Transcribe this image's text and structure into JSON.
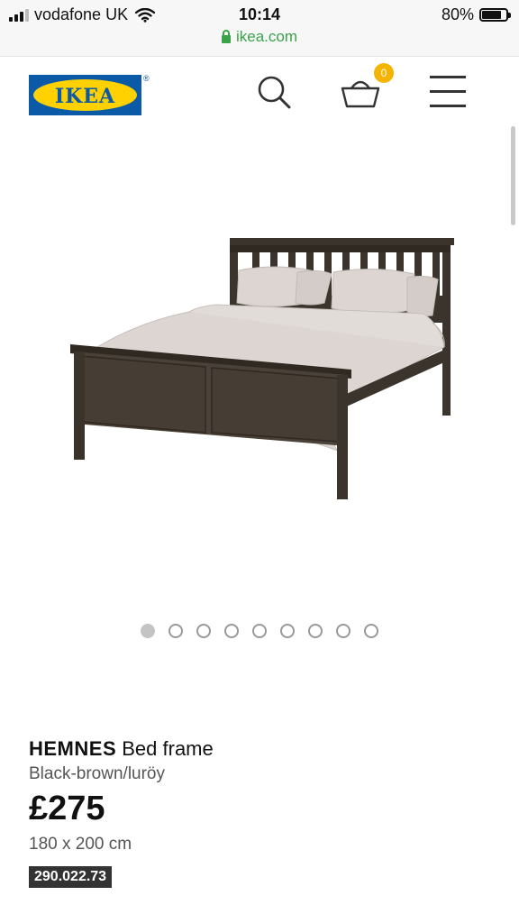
{
  "status_bar": {
    "carrier": "vodafone UK",
    "time": "10:14",
    "battery": "80%",
    "battery_level": 0.8,
    "url": "ikea.com"
  },
  "header": {
    "logo_text": "IKEA",
    "logo_reg": "®",
    "cart_count": "0",
    "icons": [
      "search-icon",
      "basket-icon",
      "menu-icon"
    ]
  },
  "gallery": {
    "image": "bed-frame-product-image",
    "dot_count": 9,
    "active_index": 0
  },
  "product": {
    "name": "HEMNES",
    "type": "Bed frame",
    "variant": "Black-brown/luröy",
    "price": "£275",
    "size": "180 x 200 cm",
    "article_number": "290.022.73"
  },
  "colors": {
    "brand_blue": "#0a5aa8",
    "brand_yellow": "#ffd100",
    "badge": "#f5b400",
    "secure_green": "#3aa34a",
    "frame": "#3b342c",
    "bedding": "#dcd5d1"
  }
}
